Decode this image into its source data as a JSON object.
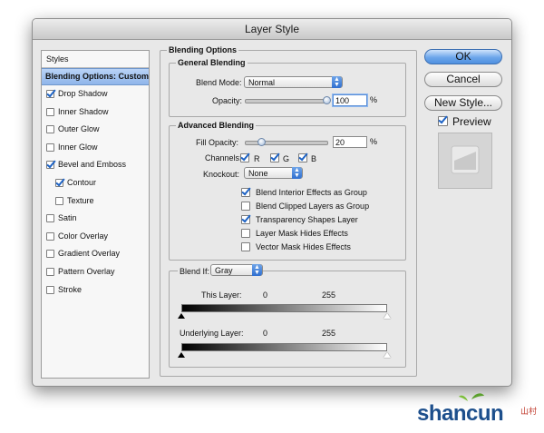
{
  "window": {
    "title": "Layer Style"
  },
  "sidebar": {
    "heading": "Styles",
    "items": [
      {
        "label": "Blending Options: Custom",
        "selected": true
      },
      {
        "label": "Drop Shadow",
        "checked": true
      },
      {
        "label": "Inner Shadow",
        "checked": false
      },
      {
        "label": "Outer Glow",
        "checked": false
      },
      {
        "label": "Inner Glow",
        "checked": false
      },
      {
        "label": "Bevel and Emboss",
        "checked": true
      },
      {
        "label": "Contour",
        "checked": true,
        "sub": true
      },
      {
        "label": "Texture",
        "checked": false,
        "sub": true
      },
      {
        "label": "Satin",
        "checked": false
      },
      {
        "label": "Color Overlay",
        "checked": false
      },
      {
        "label": "Gradient Overlay",
        "checked": false
      },
      {
        "label": "Pattern Overlay",
        "checked": false
      },
      {
        "label": "Stroke",
        "checked": false
      }
    ]
  },
  "blending_options": {
    "title": "Blending Options",
    "general": {
      "title": "General Blending",
      "blend_mode_label": "Blend Mode:",
      "blend_mode_value": "Normal",
      "opacity_label": "Opacity:",
      "opacity_value": "100",
      "percent": "%"
    },
    "advanced": {
      "title": "Advanced Blending",
      "fill_opacity_label": "Fill Opacity:",
      "fill_opacity_value": "20",
      "percent": "%",
      "channels_label": "Channels:",
      "channel_r": "R",
      "channel_g": "G",
      "channel_b": "B",
      "knockout_label": "Knockout:",
      "knockout_value": "None",
      "options": [
        {
          "label": "Blend Interior Effects as Group",
          "checked": true
        },
        {
          "label": "Blend Clipped Layers as Group",
          "checked": false
        },
        {
          "label": "Transparency Shapes Layer",
          "checked": true
        },
        {
          "label": "Layer Mask Hides Effects",
          "checked": false
        },
        {
          "label": "Vector Mask Hides Effects",
          "checked": false
        }
      ]
    },
    "blend_if": {
      "label": "Blend If:",
      "value": "Gray",
      "this_layer_label": "This Layer:",
      "this_layer_min": "0",
      "this_layer_max": "255",
      "underlying_label": "Underlying Layer:",
      "underlying_min": "0",
      "underlying_max": "255"
    }
  },
  "buttons": {
    "ok": "OK",
    "cancel": "Cancel",
    "new_style": "New Style..."
  },
  "preview": {
    "label": "Preview",
    "checked": true
  },
  "watermark": {
    "text": "shancun",
    "sub": "山村"
  },
  "colors": {
    "accent": "#2f6fd0",
    "selection": "#9ebfee"
  }
}
